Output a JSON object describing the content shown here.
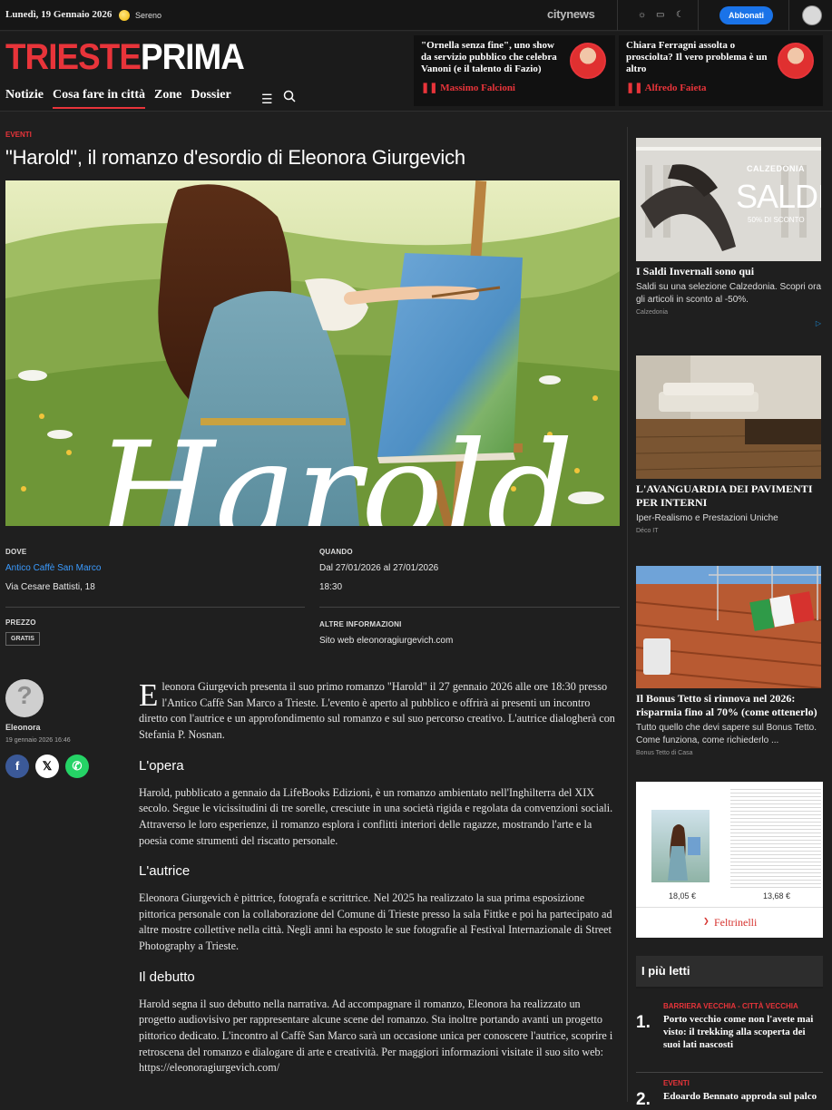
{
  "topbar": {
    "date": "Lunedì, 19 Gennaio 2026",
    "weather": "Sereno",
    "network": "citynews",
    "subscribe": "Abbonati",
    "icons": [
      "sun-icon",
      "monitor-icon",
      "moon-icon"
    ]
  },
  "header": {
    "logo_red": "TRIESTE",
    "logo_white": "PRIMA",
    "nav": [
      "Notizie",
      "Cosa fare in città",
      "Zone",
      "Dossier"
    ],
    "promos": [
      {
        "title": "\"Ornella senza fine\", uno show da servizio pubblico che celebra Vanoni (e il talento di Fazio)",
        "author": "Massimo Falcioni"
      },
      {
        "title": "Chiara Ferragni assolta o prosciolta? Il vero problema è un altro",
        "author": "Alfredo Faieta"
      }
    ]
  },
  "article": {
    "category": "EVENTI",
    "title": "\"Harold\", il romanzo d'esordio di Eleonora Giurgevich",
    "hero_script": "Harold",
    "info": {
      "where_label": "DOVE",
      "where_place": "Antico Caffè San Marco",
      "where_address": "Via Cesare Battisti, 18",
      "when_label": "QUANDO",
      "when_dates": "Dal 27/01/2026 al 27/01/2026",
      "when_time": "18:30",
      "price_label": "PREZZO",
      "price_value": "GRATIS",
      "other_label": "ALTRE INFORMAZIONI",
      "other_prefix": "Sito web",
      "other_site": "eleonoragiurgevich.com"
    },
    "author": {
      "name": "Eleonora",
      "date": "19 gennaio 2026 16:46"
    },
    "dropcap": "E",
    "intro": "leonora Giurgevich presenta il suo primo romanzo \"Harold\" il 27 gennaio 2026 alle ore 18:30 presso l'Antico Caffè San Marco a Trieste. L'evento è aperto al pubblico e offrirà ai presenti un incontro diretto con l'autrice e un approfondimento sul romanzo e sul suo percorso creativo. L'autrice dialogherà con Stefania P. Nosnan.",
    "sections": [
      {
        "heading": "L'opera",
        "text": "Harold, pubblicato a gennaio da LifeBooks Edizioni, è un romanzo ambientato nell'Inghilterra del XIX secolo. Segue le vicissitudini di tre sorelle, cresciute in una società rigida e regolata da convenzioni sociali. Attraverso le loro esperienze, il romanzo esplora i conflitti interiori delle ragazze, mostrando l'arte e la poesia come strumenti del riscatto personale."
      },
      {
        "heading": "L'autrice",
        "text": "Eleonora Giurgevich è pittrice, fotografa e scrittrice. Nel 2025 ha realizzato la sua prima esposizione pittorica personale con la collaborazione del Comune di Trieste presso la sala Fittke e poi ha partecipato ad altre mostre collettive nella città. Negli anni ha esposto le sue fotografie al Festival Internazionale di Street Photography a Trieste."
      },
      {
        "heading": "Il debutto",
        "text": "Harold segna il suo debutto nella narrativa. Ad accompagnare il romanzo, Eleonora ha realizzato un progetto audiovisivo per rappresentare alcune scene del romanzo. Sta inoltre portando avanti un progetto pittorico dedicato. L'incontro al Caffè San Marco sarà un occasione unica per conoscere l'autrice, scoprire i retroscena del romanzo e dialogare di arte e creatività. Per maggiori informazioni visitate il suo sito web: https://eleonoragiurgevich.com/"
      }
    ]
  },
  "sidebar": {
    "ads": [
      {
        "brand": "CALZEDONIA",
        "headline": "SALDI",
        "sub": "50% DI SCONTO",
        "title": "I Saldi Invernali sono qui",
        "text": "Saldi su una selezione Calzedonia. Scopri ora gli articoli in sconto al -50%.",
        "source": "Calzedonia"
      },
      {
        "title": "L'AVANGUARDIA DEI PAVIMENTI PER INTERNI",
        "text": "Iper-Realismo e Prestazioni Uniche",
        "source": "Déco IT"
      },
      {
        "title": "Il Bonus Tetto si rinnova nel 2026: risparmia fino al 70% (come ottenerlo)",
        "text": "Tutto quello che devi sapere sul Bonus Tetto. Come funziona, come richiederlo ...",
        "source": "Bonus Tetto di Casa"
      },
      {
        "price1": "18,05 €",
        "price2": "13,68 €",
        "brand": "Feltrinelli"
      }
    ],
    "popular_title": "I più letti",
    "popular": [
      {
        "num": "1.",
        "category": "BARRIERA VECCHIA - CITTÀ VECCHIA",
        "title": "Porto vecchio come non l'avete mai visto: il trekking alla scoperta dei suoi lati nascosti"
      },
      {
        "num": "2.",
        "category": "EVENTI",
        "title": "Edoardo Bennato approda sul palco"
      }
    ]
  }
}
